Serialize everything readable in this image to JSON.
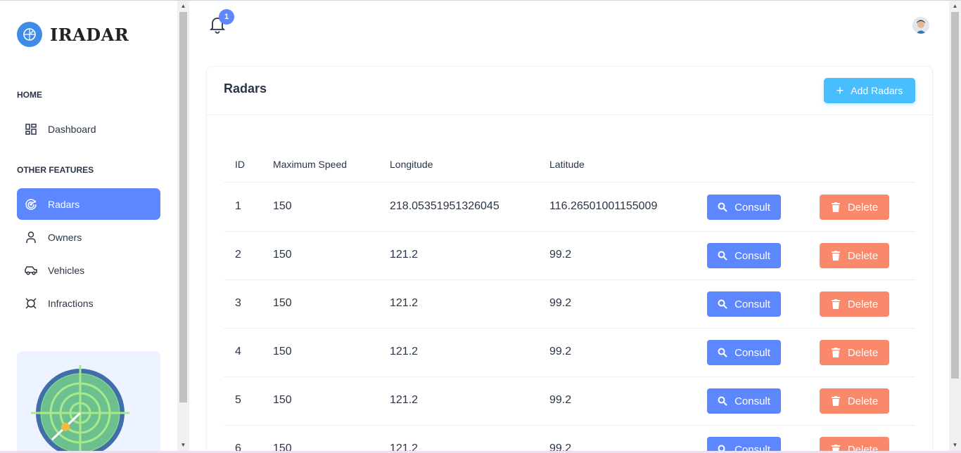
{
  "app": {
    "name": "IRADAR"
  },
  "sidebar": {
    "sections": [
      {
        "caption": "HOME"
      },
      {
        "caption": "OTHER FEATURES"
      }
    ],
    "items": [
      {
        "label": "Dashboard",
        "icon": "dashboard-icon"
      },
      {
        "label": "Radars",
        "icon": "radar-icon",
        "active": true
      },
      {
        "label": "Owners",
        "icon": "user-icon"
      },
      {
        "label": "Vehicles",
        "icon": "car-icon"
      },
      {
        "label": "Infractions",
        "icon": "infraction-icon"
      }
    ]
  },
  "header": {
    "notification_count": "1"
  },
  "card": {
    "title": "Radars",
    "add_button": "Add Radars",
    "columns": [
      "ID",
      "Maximum Speed",
      "Longitude",
      "Latitude"
    ],
    "consult_label": "Consult",
    "delete_label": "Delete",
    "rows": [
      {
        "id": "1",
        "speed": "150",
        "lon": "218.05351951326045",
        "lat": "116.26501001155009"
      },
      {
        "id": "2",
        "speed": "150",
        "lon": "121.2",
        "lat": "99.2"
      },
      {
        "id": "3",
        "speed": "150",
        "lon": "121.2",
        "lat": "99.2"
      },
      {
        "id": "4",
        "speed": "150",
        "lon": "121.2",
        "lat": "99.2"
      },
      {
        "id": "5",
        "speed": "150",
        "lon": "121.2",
        "lat": "99.2"
      },
      {
        "id": "6",
        "speed": "150",
        "lon": "121.2",
        "lat": "99.2"
      }
    ]
  },
  "colors": {
    "primary": "#5d87ff",
    "secondary": "#49beff",
    "danger": "#fa896b",
    "text": "#2a3547"
  }
}
